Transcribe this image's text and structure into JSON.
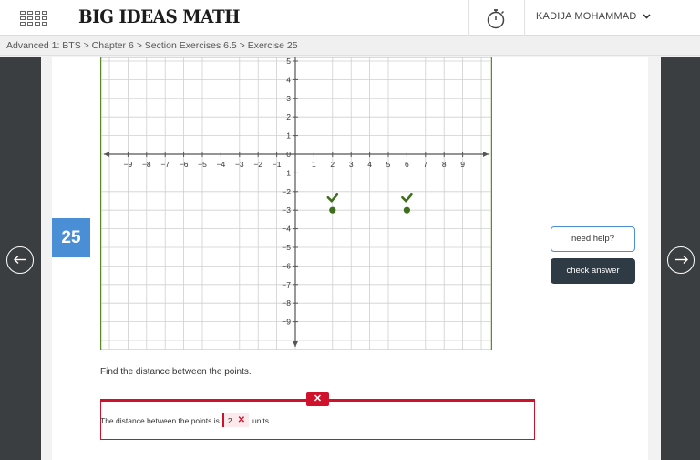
{
  "header": {
    "brand": "BIG IDEAS MATH",
    "user_name": "KADIJA MOHAMMAD"
  },
  "breadcrumb": "Advanced 1: BTS > Chapter 6 > Section Exercises 6.5 > Exercise 25",
  "exercise": {
    "number": "25",
    "prompt": "Find the distance between the points.",
    "answer_before": "The distance between the points is",
    "answer_value": "2",
    "answer_after": "units.",
    "feedback_mark": "✕",
    "wrong_mark": "✕"
  },
  "buttons": {
    "help": "need help?",
    "check": "check answer"
  },
  "colors": {
    "accent_blue": "#4a8fd6",
    "error_red": "#d0112b",
    "point_green": "#3f6f1e",
    "dark_button": "#2e3a44"
  },
  "chart_data": {
    "type": "scatter",
    "x_ticks": [
      "-9",
      "-8",
      "-7",
      "-6",
      "-5",
      "-4",
      "-3",
      "-2",
      "-1",
      "1",
      "2",
      "3",
      "4",
      "5",
      "6",
      "7",
      "8",
      "9"
    ],
    "y_ticks_positive": [
      "5",
      "4",
      "3",
      "2",
      "1"
    ],
    "y_ticks_negative": [
      "-1",
      "-2",
      "-3",
      "-4",
      "-5",
      "-6",
      "-7",
      "-8",
      "-9"
    ],
    "origin_label": "0",
    "xlim": [
      -10,
      10
    ],
    "ylim": [
      -10,
      5
    ],
    "grid": true,
    "points": [
      {
        "x": 2,
        "y": -3,
        "correct": true
      },
      {
        "x": 6,
        "y": -3,
        "correct": true
      }
    ]
  }
}
